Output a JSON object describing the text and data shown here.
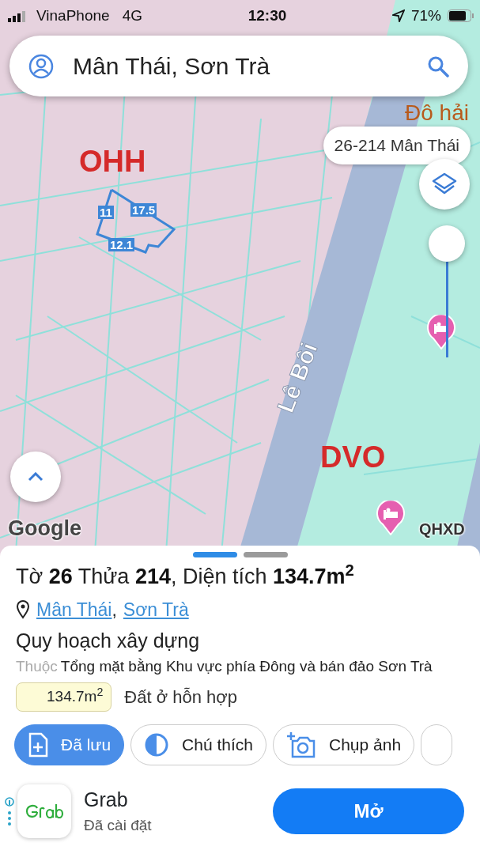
{
  "status_bar": {
    "carrier": "VinaPhone",
    "network": "4G",
    "time": "12:30",
    "battery": "71%"
  },
  "search": {
    "value": "Mân Thái, Sơn Trà"
  },
  "map": {
    "labels": [
      {
        "text": "Đô hải",
        "kind": "place"
      },
      {
        "text": "OHH",
        "kind": "zone"
      },
      {
        "text": "Lê Bôi",
        "kind": "street"
      },
      {
        "text": "DVO",
        "kind": "zone"
      }
    ],
    "parcel_lengths": [
      "11",
      "17.5",
      "12.1"
    ],
    "parcel_tag": "26-214 Mân Thái",
    "opacity_slider": {
      "level": 1
    },
    "attribution": "Google",
    "layer_tag": "QHXD"
  },
  "sheet": {
    "page_dots": [
      {
        "selected": true
      },
      {
        "selected": false
      }
    ],
    "title": "Tờ **26** Thửa **214**, Diện tích **134.7m$^{2}$**",
    "location_links": [
      "Mân Thái",
      "Sơn Trà"
    ],
    "location_separator": ",",
    "section": "Quy hoạch xây dựng",
    "belongs_prefix": "Thuộc",
    "plan_name": "Tổng mặt bằng Khu vực phía Đông và bán đảo Sơn Trà",
    "zoning": {
      "area": "134.7m$^{2}$",
      "use": "Đất ở hỗn hợp"
    },
    "actions": [
      {
        "label": "Đã lưu",
        "kind": "save",
        "selected": true
      },
      {
        "label": "Chú thích",
        "kind": "legend",
        "selected": false
      },
      {
        "label": "Chụp ảnh",
        "kind": "photo",
        "selected": false
      }
    ]
  },
  "app_banner": {
    "name": "Grab",
    "status": "Đã cài đặt",
    "button": "Mở"
  }
}
